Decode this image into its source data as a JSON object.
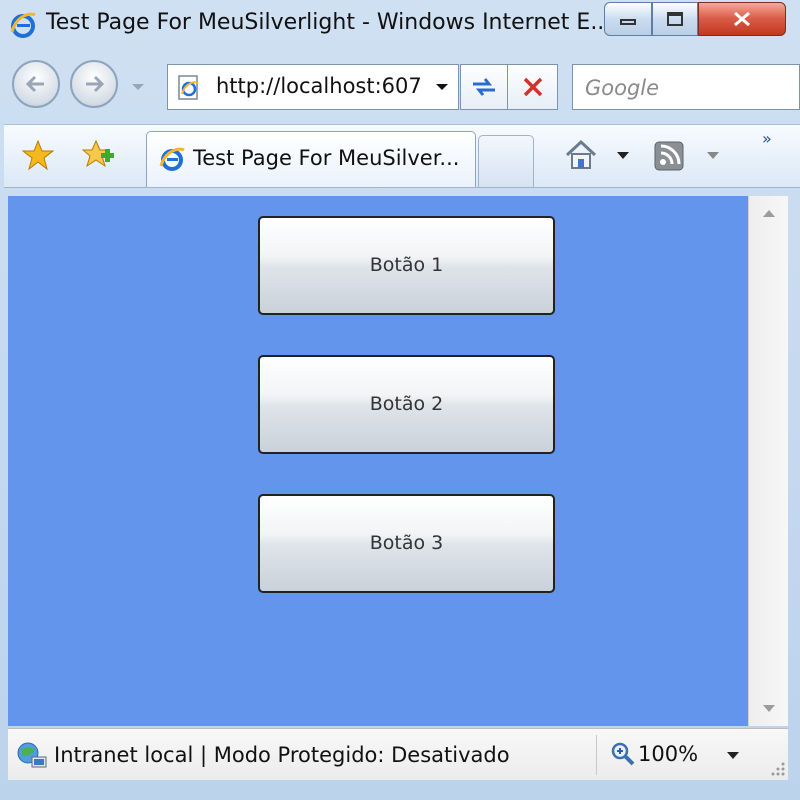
{
  "window": {
    "title": "Test Page For MeuSilverlight - Windows Internet E..."
  },
  "toolbar": {
    "address": "http://localhost:607",
    "search_placeholder": "Google",
    "more": "»"
  },
  "tabs": [
    {
      "label": "Test Page For MeuSilver...",
      "active": true
    }
  ],
  "content": {
    "background_color": "#6495ed",
    "buttons": [
      {
        "label": "Botão 1"
      },
      {
        "label": "Botão 2"
      },
      {
        "label": "Botão 3"
      }
    ]
  },
  "statusbar": {
    "zone_text": "Intranet local | Modo Protegido: Desativado",
    "zoom": "100%"
  }
}
